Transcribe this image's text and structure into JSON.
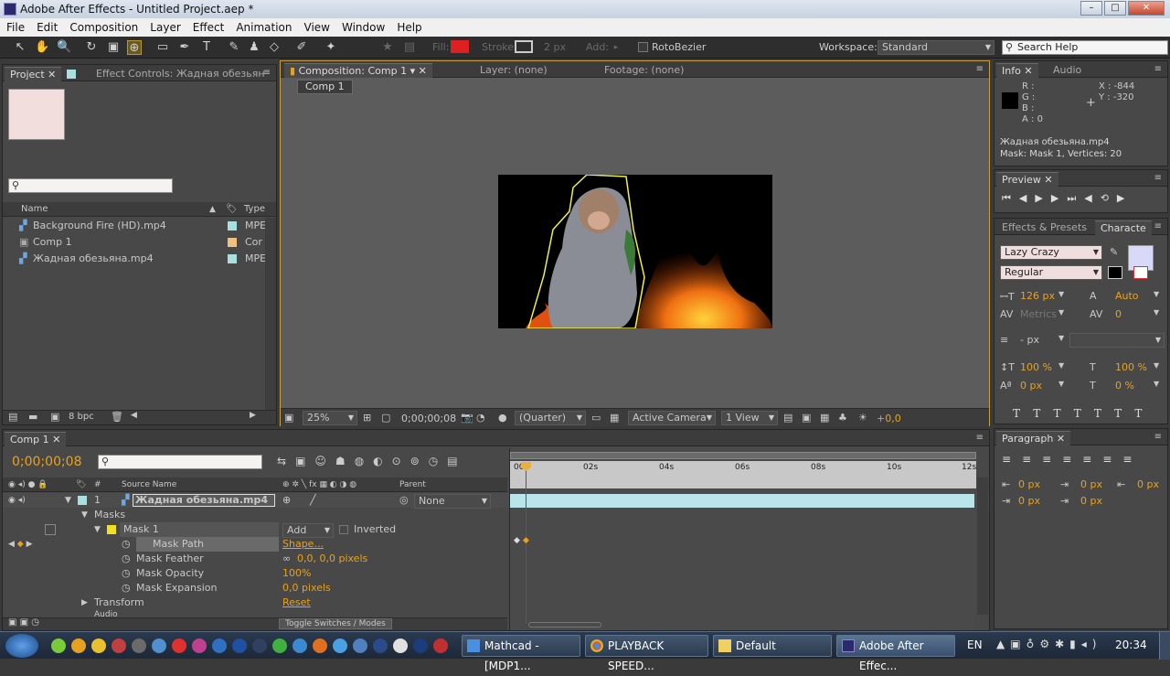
{
  "window": {
    "title": "Adobe After Effects - Untitled Project.aep *"
  },
  "menu": [
    "File",
    "Edit",
    "Composition",
    "Layer",
    "Effect",
    "Animation",
    "View",
    "Window",
    "Help"
  ],
  "toolbar": {
    "fill_label": "Fill:",
    "stroke_label": "Stroke:",
    "stroke_width": "2 px",
    "add_label": "Add:",
    "rotobezier": "RotoBezier",
    "workspace_label": "Workspace:",
    "workspace_value": "Standard",
    "search_help": "Search Help",
    "fill_color": "#e02020"
  },
  "project": {
    "tab": "Project",
    "effect_controls_tab": "Effect Controls: Жадная обезьян",
    "columns": {
      "name": "Name",
      "type": "Type"
    },
    "items": [
      {
        "name": "Background Fire (HD).mp4",
        "type": "MPE",
        "color": "#a8e0e0",
        "icon": "footage-icon"
      },
      {
        "name": "Comp 1",
        "type": "Cor",
        "color": "#f0c080",
        "icon": "composition-icon"
      },
      {
        "name": "Жадная обезьяна.mp4",
        "type": "MPE",
        "color": "#a8e0e0",
        "icon": "footage-icon"
      }
    ],
    "bpc": "8 bpc"
  },
  "composition": {
    "tab": "Composition: Comp 1",
    "layer_tab": "Layer: (none)",
    "footage_tab": "Footage: (none)",
    "breadcrumb": "Comp 1",
    "zoom": "25%",
    "timecode": "0;00;00;08",
    "resolution": "(Quarter)",
    "camera": "Active Camera",
    "views": "1 View",
    "exposure": "+0,0"
  },
  "info": {
    "tab": "Info",
    "audio_tab": "Audio",
    "r": "R :",
    "g": "G :",
    "b": "B :",
    "a": "A : 0",
    "x": "X : -844",
    "y": "Y : -320",
    "line1": "Жадная обезьяна.mp4",
    "line2": "Mask: Mask 1, Vertices: 20"
  },
  "preview": {
    "tab": "Preview"
  },
  "character": {
    "effects_tab": "Effects & Presets",
    "char_tab": "Characte",
    "font": "Lazy Crazy",
    "style": "Regular",
    "size": "126 px",
    "leading": "Auto",
    "kerning": "Metrics",
    "tracking": "0",
    "stroke_width": "- px",
    "vscale": "100 %",
    "hscale": "100 %",
    "baseline": "0 px",
    "tsume": "0 %"
  },
  "paragraph": {
    "tab": "Paragraph",
    "indent1": "0 px",
    "indent2": "0 px",
    "indent3": "0 px",
    "space1": "0 px",
    "space2": "0 px"
  },
  "timeline": {
    "tab": "Comp 1",
    "timecode": "0;00;00;08",
    "columns": {
      "source": "Source Name",
      "parent": "Parent"
    },
    "layer": {
      "num": "1",
      "name": "Жадная обезьяна.mp4",
      "parent": "None"
    },
    "masks_label": "Masks",
    "mask1": "Mask 1",
    "mask_mode": "Add",
    "inverted": "Inverted",
    "mask_path": "Mask Path",
    "mask_path_value": "Shape...",
    "mask_feather": "Mask Feather",
    "mask_feather_value": "0,0, 0,0 pixels",
    "mask_opacity": "Mask Opacity",
    "mask_opacity_value": "100%",
    "mask_expansion": "Mask Expansion",
    "mask_expansion_value": "0,0 pixels",
    "transform": "Transform",
    "transform_value": "Reset",
    "audio": "Audio",
    "toggle": "Toggle Switches / Modes",
    "ruler": [
      "00s",
      "02s",
      "04s",
      "06s",
      "08s",
      "10s",
      "12s"
    ]
  },
  "taskbar": {
    "items": [
      "Mathcad - [MDP1...",
      "PLAYBACK SPEED...",
      "Default",
      "Adobe After Effec..."
    ],
    "lang": "EN",
    "clock": "20:34"
  }
}
